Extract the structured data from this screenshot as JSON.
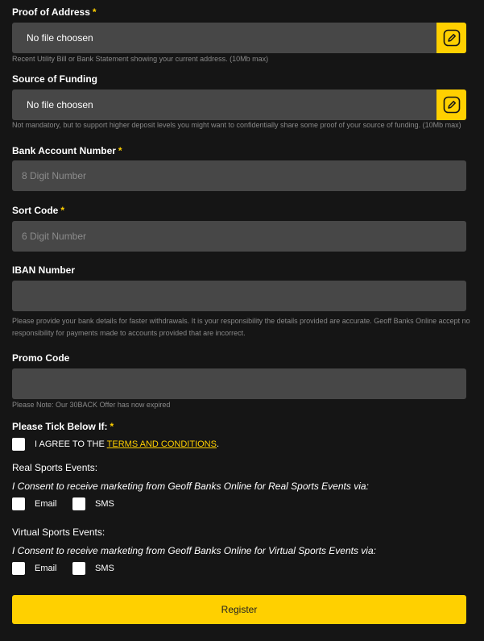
{
  "required_marker": "*",
  "proof_of_address": {
    "label": "Proof of Address",
    "file_text": "No file choosen",
    "help": "Recent Utility Bill or Bank Statement showing your current address. (10Mb max)",
    "icon": "edit-icon"
  },
  "source_of_funding": {
    "label": "Source of Funding",
    "file_text": "No file choosen",
    "help": "Not mandatory, but to support higher deposit levels you might want to confidentially share some proof of your source of funding. (10Mb max)",
    "icon": "edit-icon"
  },
  "bank_account": {
    "label": "Bank Account Number",
    "placeholder": "8 Digit Number",
    "value": ""
  },
  "sort_code": {
    "label": "Sort Code",
    "placeholder": "6 Digit Number",
    "value": ""
  },
  "iban": {
    "label": "IBAN Number",
    "placeholder": "",
    "value": "",
    "help_line1": "Please provide your bank details for faster withdrawals. It is your responsibility the details provided are accurate. Geoff Banks Online accept no",
    "help_line2": "responsibility for payments made to accounts provided that are incorrect."
  },
  "promo": {
    "label": "Promo Code",
    "placeholder": "",
    "value": "",
    "help": "Please Note: Our 30BACK Offer has now expired"
  },
  "terms": {
    "label": "Please Tick Below If:",
    "agree_prefix": "I AGREE TO THE",
    "link_text": "TERMS AND CONDITIONS",
    "suffix": ".",
    "checked": false
  },
  "real_sports": {
    "label": "Real Sports Events:",
    "consent": "I Consent to receive marketing from Geoff Banks Online for Real Sports Events via:",
    "email_label": "Email",
    "sms_label": "SMS"
  },
  "virtual_sports": {
    "label": "Virtual Sports Events:",
    "consent": "I Consent to receive marketing from Geoff Banks Online for Virtual Sports Events via:",
    "email_label": "Email",
    "sms_label": "SMS"
  },
  "register_label": "Register",
  "colors": {
    "background": "#151515",
    "accent": "#ffd000",
    "field": "#474747",
    "help_text": "#8a8a8a"
  }
}
